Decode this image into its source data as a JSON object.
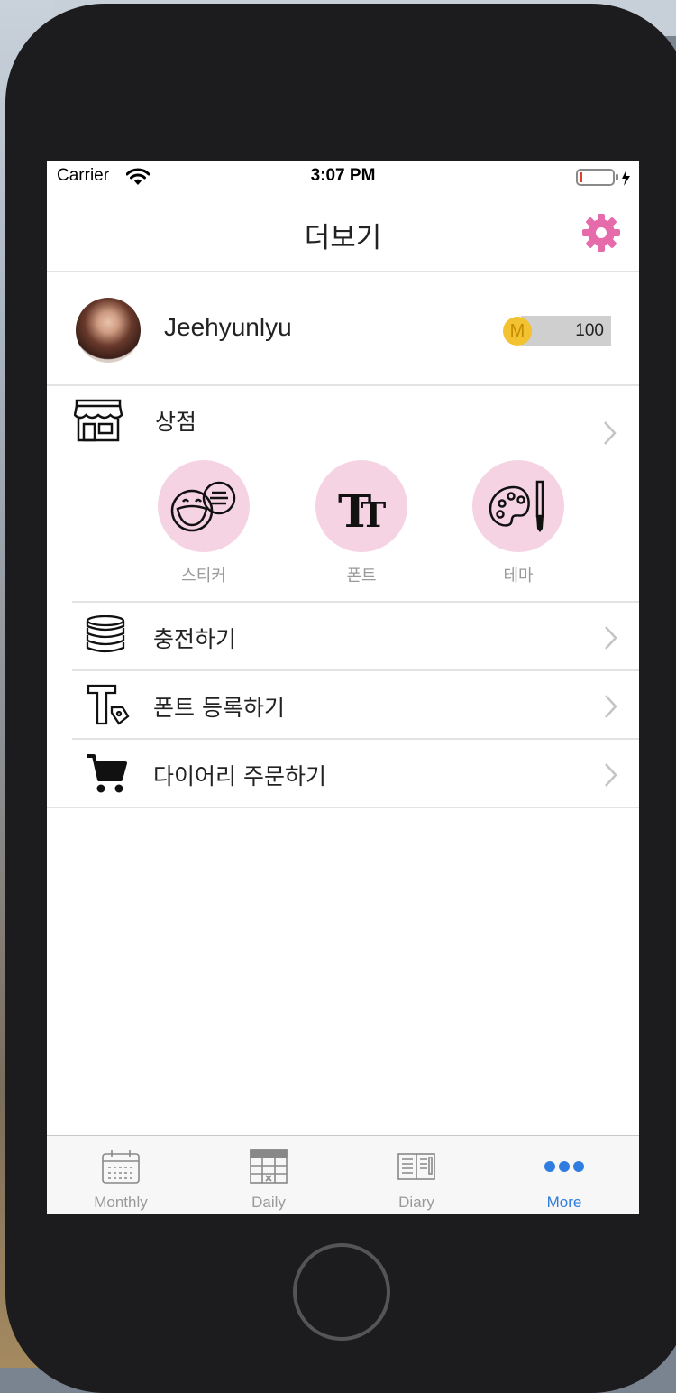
{
  "status_bar": {
    "carrier": "Carrier",
    "time": "3:07 PM"
  },
  "nav": {
    "title": "더보기"
  },
  "profile": {
    "username": "Jeehyunlyu",
    "coin_symbol": "M",
    "coin_balance": "100"
  },
  "shop": {
    "label": "상점",
    "items": [
      {
        "label": "스티커",
        "icon": "sticker-icon"
      },
      {
        "label": "폰트",
        "icon": "font-icon"
      },
      {
        "label": "테마",
        "icon": "palette-icon"
      }
    ]
  },
  "menu": [
    {
      "label": "충전하기",
      "icon": "coins-icon"
    },
    {
      "label": "폰트 등록하기",
      "icon": "font-register-icon"
    },
    {
      "label": "다이어리 주문하기",
      "icon": "cart-icon"
    }
  ],
  "tabs": [
    {
      "label": "Monthly",
      "icon": "calendar-icon"
    },
    {
      "label": "Daily",
      "icon": "daily-calendar-icon"
    },
    {
      "label": "Diary",
      "icon": "diary-icon"
    },
    {
      "label": "More",
      "icon": "more-dots-icon",
      "active": true
    }
  ],
  "colors": {
    "accent_pink": "#e56bab",
    "tab_active": "#2f7de1",
    "shop_circle": "#f5d3e3",
    "coin": "#f2c230"
  }
}
